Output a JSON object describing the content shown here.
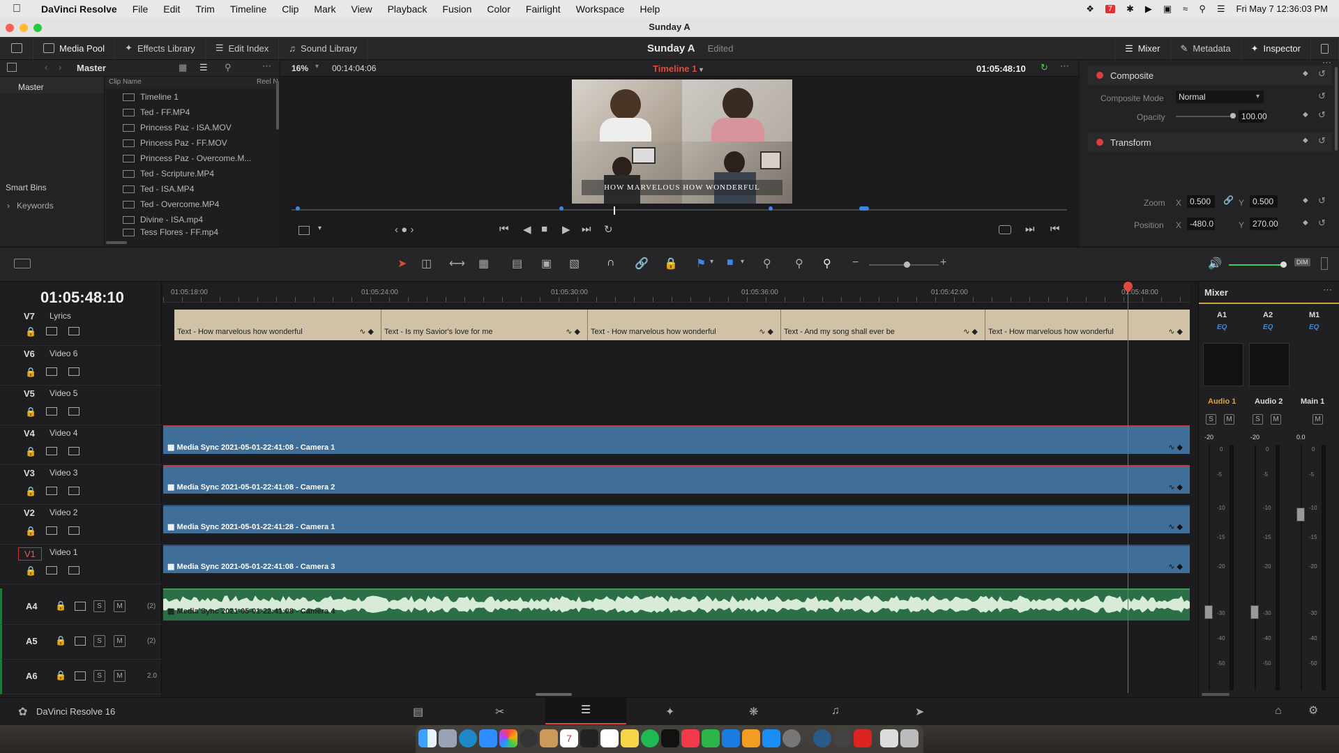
{
  "menubar": {
    "app": "DaVinci Resolve",
    "items": [
      "File",
      "Edit",
      "Trim",
      "Timeline",
      "Clip",
      "Mark",
      "View",
      "Playback",
      "Fusion",
      "Color",
      "Fairlight",
      "Workspace",
      "Help"
    ],
    "clock": "Fri May 7  12:36:03 PM",
    "calendar_day": "7"
  },
  "window": {
    "title": "Sunday A"
  },
  "toolbar": {
    "media_pool": "Media Pool",
    "effects": "Effects Library",
    "edit_index": "Edit Index",
    "sound_library": "Sound Library",
    "project": "Sunday A",
    "edited": "Edited",
    "mixer": "Mixer",
    "metadata": "Metadata",
    "inspector": "Inspector"
  },
  "media_pool": {
    "bin_title": "Master",
    "master": "Master",
    "smart_bins": "Smart Bins",
    "keywords": "Keywords",
    "col_clip": "Clip Name",
    "col_reel": "Reel N",
    "clips": [
      "Timeline 1",
      "Ted - FF.MP4",
      "Princess Paz - ISA.MOV",
      "Princess Paz - FF.MOV",
      "Princess Paz - Overcome.M...",
      "Ted - Scripture.MP4",
      "Ted - ISA.MP4",
      "Ted - Overcome.MP4",
      "Divine - ISA.mp4",
      "Tess Flores - FF.mp4"
    ]
  },
  "viewer": {
    "zoom": "16%",
    "src_tc": "00:14:04:06",
    "timeline": "Timeline 1",
    "tc": "01:05:48:10",
    "caption": "HOW MARVELOUS HOW WONDERFUL"
  },
  "inspector": {
    "composite": "Composite",
    "composite_mode_label": "Composite Mode",
    "composite_mode": "Normal",
    "opacity_label": "Opacity",
    "opacity": "100.00",
    "opacity_level": 1.0,
    "transform": "Transform",
    "zoom_label": "Zoom",
    "zoom_x": "0.500",
    "zoom_y": "0.500",
    "position_label": "Position",
    "pos_x": "-480.0",
    "pos_y": "270.00",
    "x": "X",
    "y": "Y"
  },
  "timeline": {
    "timecode": "01:05:48:10",
    "ruler": [
      "01:05:18:00",
      "01:05:24:00",
      "01:05:30:00",
      "01:05:36:00",
      "01:05:42:00",
      "01:05:48:00"
    ],
    "tracks": [
      {
        "id": "V7",
        "name": "Lyrics"
      },
      {
        "id": "V6",
        "name": "Video 6"
      },
      {
        "id": "V5",
        "name": "Video 5"
      },
      {
        "id": "V4",
        "name": "Video 4"
      },
      {
        "id": "V3",
        "name": "Video 3"
      },
      {
        "id": "V2",
        "name": "Video 2"
      },
      {
        "id": "V1",
        "name": "Video 1"
      }
    ],
    "audio": [
      {
        "id": "A4",
        "ch": "(2)"
      },
      {
        "id": "A5",
        "ch": "(2)"
      },
      {
        "id": "A6",
        "ch": "2.0"
      }
    ],
    "lyrics": [
      "Text - How marvelous how wonderful",
      "Text - Is my Savior's love for me",
      "Text - How marvelous how wonderful",
      "Text - And my song shall ever be",
      "Text - How marvelous how wonderful"
    ],
    "video_clips": [
      "Media Sync 2021-05-01-22:41:08 - Camera 1",
      "Media Sync 2021-05-01-22:41:08 - Camera 2",
      "Media Sync 2021-05-01-22:41:28 - Camera 1",
      "Media Sync 2021-05-01-22:41:08 - Camera 3"
    ],
    "audio_clip": "Media Sync 2021-05-01-22:41:08 - Camera 4",
    "s": "S",
    "m": "M"
  },
  "mixer": {
    "title": "Mixer",
    "channels": [
      {
        "id": "A1",
        "name": "Audio 1",
        "level": "-20"
      },
      {
        "id": "A2",
        "name": "Audio 2",
        "level": "-20"
      },
      {
        "id": "M1",
        "name": "Main 1",
        "level": "0.0"
      }
    ],
    "eq": "EQ",
    "dim": "DIM",
    "scale": [
      "0",
      "-5",
      "-10",
      "-15",
      "-20",
      "-30",
      "-40",
      "-50"
    ]
  },
  "footer": {
    "app_version": "DaVinci Resolve 16"
  }
}
